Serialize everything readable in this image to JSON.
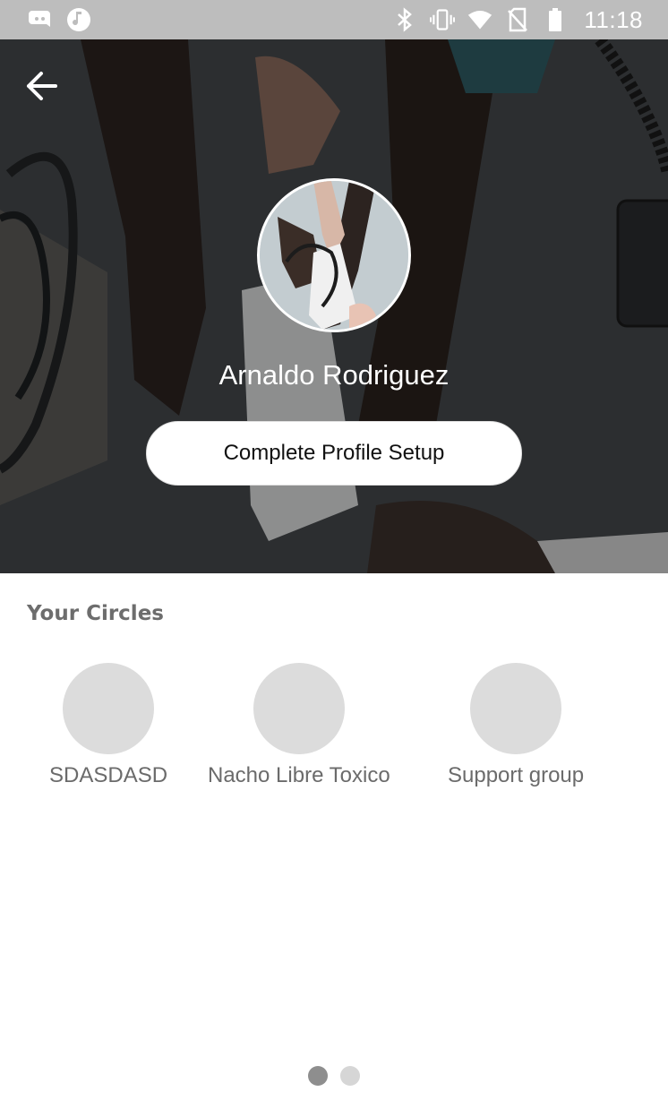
{
  "status_bar": {
    "left_icons": [
      "discord-icon",
      "music-note-icon"
    ],
    "right_icons": [
      "bluetooth-icon",
      "vibrate-icon",
      "wifi-icon",
      "no-sim-icon",
      "battery-icon"
    ],
    "time": "11:18"
  },
  "header": {
    "back_icon": "arrow-left-icon",
    "profile_name": "Arnaldo Rodriguez",
    "setup_button_label": "Complete Profile Setup"
  },
  "circles": {
    "title": "Your Circles",
    "items": [
      {
        "label": "SDASDASD"
      },
      {
        "label": "Nacho Libre Toxico"
      },
      {
        "label": "Support group"
      }
    ]
  },
  "pagination": {
    "current_page": 1,
    "total_pages": 2
  },
  "colors": {
    "status_bar": "#bdbdbd",
    "hero_overlay": "#3a3d40",
    "circle_placeholder": "#dcdcdc",
    "section_title": "#6d6d6d",
    "dot_active": "#8e8e8e",
    "dot_inactive": "#d6d6d6"
  }
}
